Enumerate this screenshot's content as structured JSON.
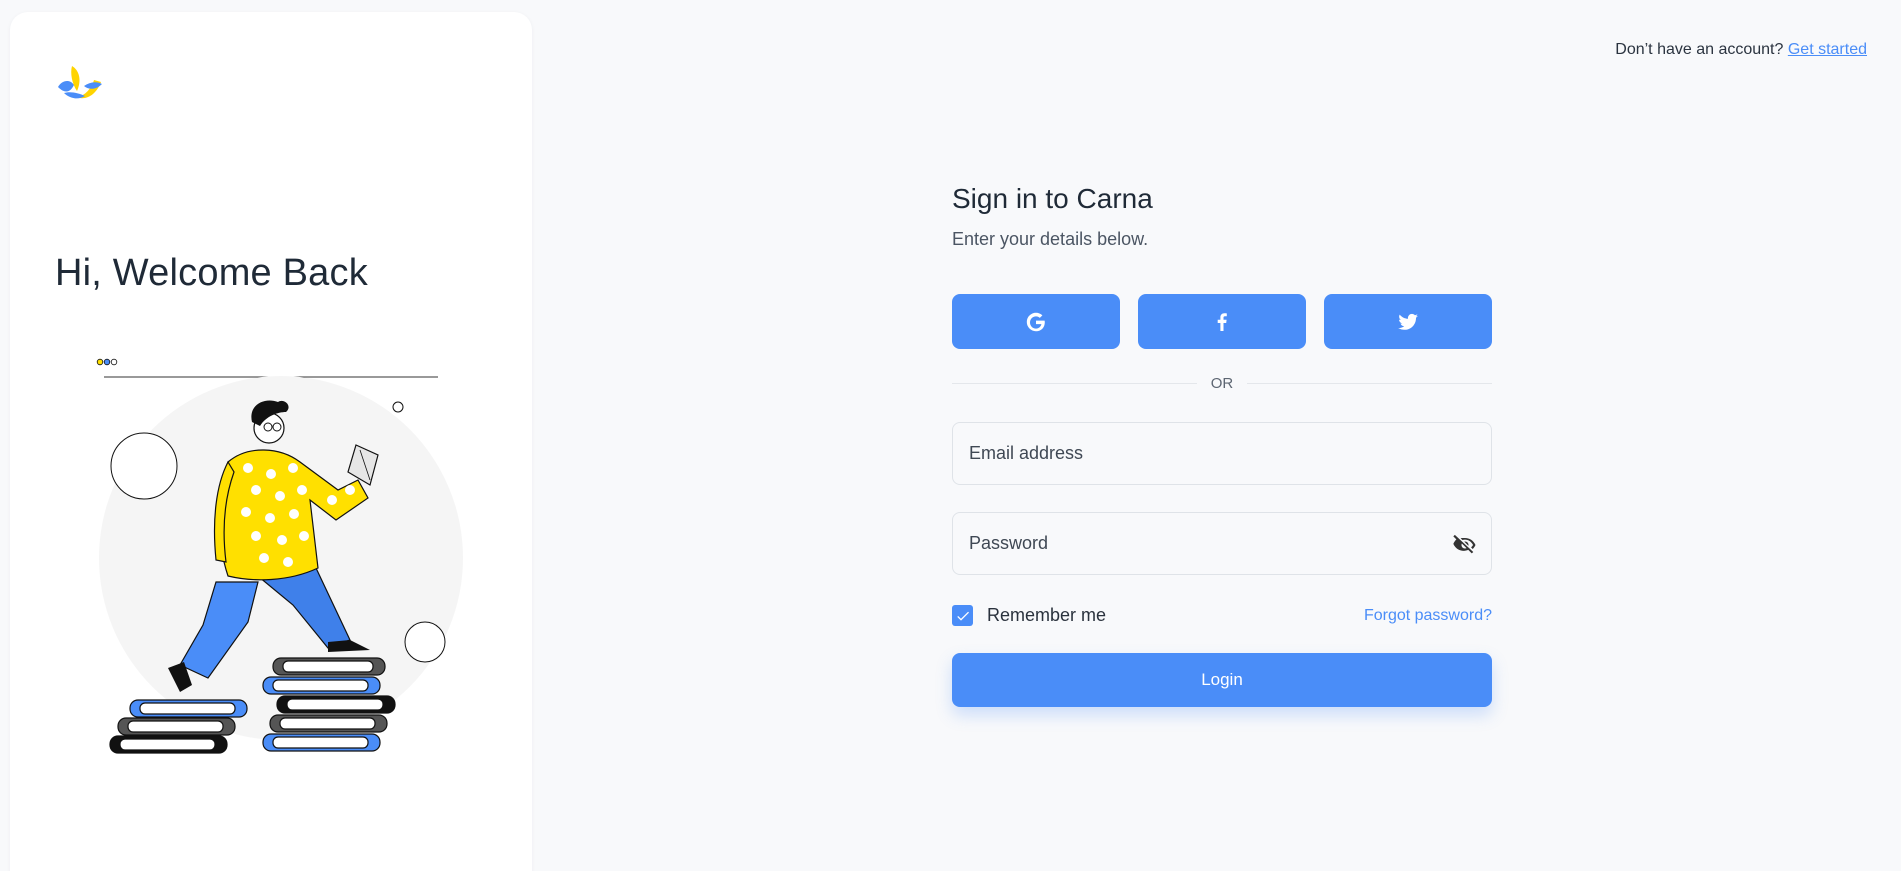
{
  "left": {
    "welcome": "Hi, Welcome Back",
    "logo_icon": "carna-logo-icon",
    "illustration_icon": "reading-man-on-books-illustration"
  },
  "topbar": {
    "prompt": "Don’t have an account?",
    "link": "Get started"
  },
  "form": {
    "title": "Sign in to Carna",
    "subtitle": "Enter your details below.",
    "social": [
      {
        "name": "google",
        "icon": "google-icon"
      },
      {
        "name": "facebook",
        "icon": "facebook-icon"
      },
      {
        "name": "twitter",
        "icon": "twitter-icon"
      }
    ],
    "divider": "OR",
    "email_placeholder": "Email address",
    "password_placeholder": "Password",
    "remember": "Remember me",
    "remember_checked": true,
    "forgot": "Forgot password?",
    "login": "Login"
  },
  "colors": {
    "accent": "#4a8df8",
    "background": "#f8f9fb",
    "illustration_yellow": "#ffe000"
  }
}
